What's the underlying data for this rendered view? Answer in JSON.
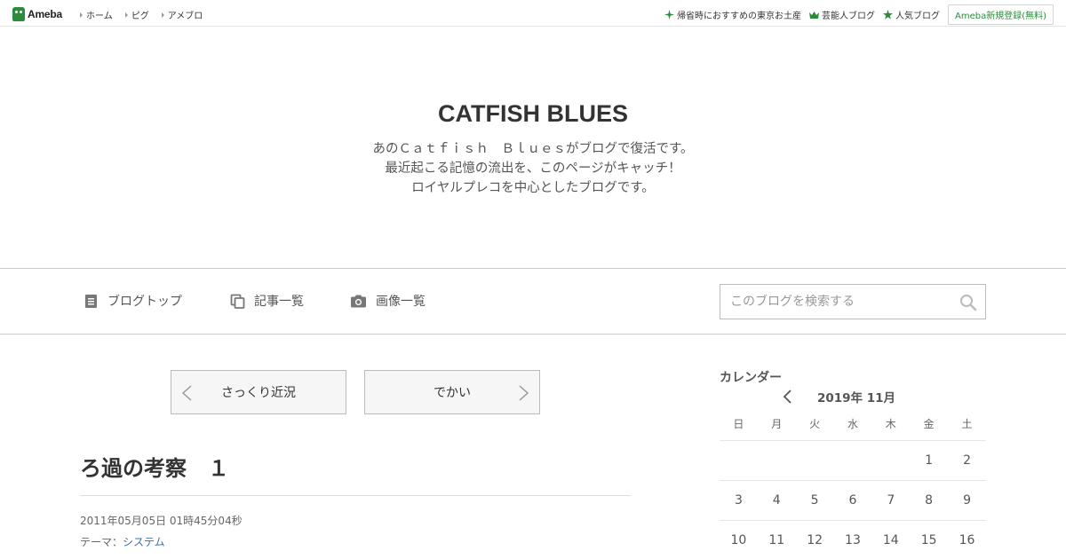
{
  "topbar": {
    "logo": "Ameba",
    "nav": [
      "ホーム",
      "ピグ",
      "アメブロ"
    ],
    "links": [
      {
        "icon": "sparkle-icon",
        "label": "帰省時におすすめの東京お土産"
      },
      {
        "icon": "crown-icon",
        "label": "芸能人ブログ"
      },
      {
        "icon": "star-icon",
        "label": "人気ブログ"
      }
    ],
    "signup": "Ameba新規登録(無料)"
  },
  "header": {
    "title": "CATFISH BLUES",
    "description": [
      "あのＣａｔｆｉｓｈ　Ｂｌｕｅｓがブログで復活です。",
      "最近起こる記憶の流出を、このページがキャッチ！",
      "ロイヤルプレコを中心としたブログです。"
    ]
  },
  "blognav": {
    "top": "ブログトップ",
    "entries": "記事一覧",
    "images": "画像一覧",
    "search_placeholder": "このブログを検索する"
  },
  "pager": {
    "prev": "さっくり近況",
    "next": "でかい"
  },
  "entry": {
    "title": "ろ過の考察　１",
    "date": "2011年05月05日 01時45分04秒",
    "theme_label": "テーマ：",
    "theme": "システム"
  },
  "calendar": {
    "heading": "カレンダー",
    "month": "2019年 11月",
    "weekdays": [
      "日",
      "月",
      "火",
      "水",
      "木",
      "金",
      "土"
    ],
    "weeks": [
      [
        "",
        "",
        "",
        "",
        "",
        "1",
        "2"
      ],
      [
        "3",
        "4",
        "5",
        "6",
        "7",
        "8",
        "9"
      ],
      [
        "10",
        "11",
        "12",
        "13",
        "14",
        "15",
        "16"
      ]
    ]
  },
  "colors": {
    "brand": "#2d8c3c",
    "link": "#3a6fb0"
  }
}
